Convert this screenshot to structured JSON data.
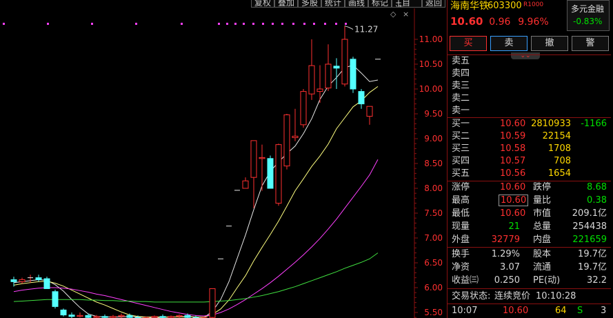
{
  "toolbar": {
    "buttons": [
      "复权",
      "叠加",
      "多股",
      "统计",
      "画线",
      "标记",
      "+自选",
      "返回"
    ]
  },
  "chart_controls": {
    "expand": "◇",
    "close": "×"
  },
  "chart_data": {
    "type": "candlestick",
    "y_tick_labels": [
      "11.00",
      "10.50",
      "10.00",
      "9.50",
      "9.00",
      "8.50",
      "8.00",
      "7.50",
      "7.00",
      "6.50",
      "6.00",
      "5.50"
    ],
    "ylim": [
      5.5,
      11.0
    ],
    "max_label": "11.27",
    "candles": [
      {
        "o": 6.16,
        "h": 6.22,
        "l": 6.02,
        "c": 6.12
      },
      {
        "o": 6.12,
        "h": 6.2,
        "l": 6.08,
        "c": 6.16
      },
      {
        "o": 6.2,
        "h": 6.26,
        "l": 6.1,
        "c": 6.2
      },
      {
        "o": 6.2,
        "h": 6.26,
        "l": 6.12,
        "c": 6.16
      },
      {
        "o": 6.18,
        "h": 6.22,
        "l": 5.98,
        "c": 5.98
      },
      {
        "o": 5.92,
        "h": 5.96,
        "l": 5.58,
        "c": 5.62
      },
      {
        "o": 5.55,
        "h": 5.58,
        "l": 5.42,
        "c": 5.45
      },
      {
        "o": 5.45,
        "h": 5.5,
        "l": 5.38,
        "c": 5.42
      },
      {
        "o": 5.42,
        "h": 5.5,
        "l": 5.4,
        "c": 5.44
      },
      {
        "o": 5.44,
        "h": 5.48,
        "l": 5.38,
        "c": 5.4
      },
      {
        "o": 5.4,
        "h": 5.45,
        "l": 5.35,
        "c": 5.42
      },
      {
        "o": 5.42,
        "h": 5.46,
        "l": 5.38,
        "c": 5.4
      },
      {
        "o": 5.4,
        "h": 5.45,
        "l": 5.36,
        "c": 5.42
      },
      {
        "o": 5.42,
        "h": 5.48,
        "l": 5.38,
        "c": 5.44
      },
      {
        "o": 5.44,
        "h": 5.48,
        "l": 5.38,
        "c": 5.4
      },
      {
        "o": 5.4,
        "h": 5.44,
        "l": 5.35,
        "c": 5.38
      },
      {
        "o": 5.38,
        "h": 5.42,
        "l": 5.34,
        "c": 5.4
      },
      {
        "o": 5.4,
        "h": 5.44,
        "l": 5.36,
        "c": 5.42
      },
      {
        "o": 5.42,
        "h": 5.46,
        "l": 5.38,
        "c": 5.4
      },
      {
        "o": 5.4,
        "h": 5.44,
        "l": 5.36,
        "c": 5.42
      },
      {
        "o": 5.42,
        "h": 5.46,
        "l": 5.38,
        "c": 5.44
      },
      {
        "o": 5.44,
        "h": 5.48,
        "l": 5.38,
        "c": 5.4
      },
      {
        "o": 5.4,
        "h": 5.44,
        "l": 5.35,
        "c": 5.38
      },
      {
        "o": 5.38,
        "h": 5.42,
        "l": 5.34,
        "c": 5.4
      },
      {
        "o": 5.4,
        "h": 5.98,
        "l": 5.38,
        "c": 5.98
      },
      {
        "o": 6.58,
        "h": 6.58,
        "l": 6.58,
        "c": 6.58
      },
      {
        "o": 7.24,
        "h": 7.24,
        "l": 7.24,
        "c": 7.24
      },
      {
        "o": 7.96,
        "h": 7.96,
        "l": 7.96,
        "c": 7.96
      },
      {
        "o": 8.0,
        "h": 8.22,
        "l": 8.0,
        "c": 8.15
      },
      {
        "o": 8.22,
        "h": 8.96,
        "l": 7.6,
        "c": 8.96
      },
      {
        "o": 8.6,
        "h": 8.88,
        "l": 7.95,
        "c": 8.62
      },
      {
        "o": 8.6,
        "h": 8.66,
        "l": 8.0,
        "c": 8.0
      },
      {
        "o": 7.7,
        "h": 8.9,
        "l": 7.65,
        "c": 8.88
      },
      {
        "o": 8.45,
        "h": 9.5,
        "l": 8.38,
        "c": 9.48
      },
      {
        "o": 9.02,
        "h": 9.6,
        "l": 8.95,
        "c": 9.05
      },
      {
        "o": 9.28,
        "h": 10.0,
        "l": 9.22,
        "c": 9.95
      },
      {
        "o": 9.9,
        "h": 11.0,
        "l": 9.78,
        "c": 10.47
      },
      {
        "o": 9.95,
        "h": 10.48,
        "l": 9.72,
        "c": 10.0
      },
      {
        "o": 10.02,
        "h": 10.9,
        "l": 9.96,
        "c": 10.5
      },
      {
        "o": 10.46,
        "h": 10.62,
        "l": 10.0,
        "c": 10.42
      },
      {
        "o": 10.1,
        "h": 11.27,
        "l": 10.05,
        "c": 11.0
      },
      {
        "o": 10.6,
        "h": 10.65,
        "l": 9.92,
        "c": 10.0
      },
      {
        "o": 9.95,
        "h": 10.0,
        "l": 9.6,
        "c": 9.7
      },
      {
        "o": 9.45,
        "h": 9.65,
        "l": 9.28,
        "c": 9.65
      },
      {
        "o": 10.6,
        "h": 10.6,
        "l": 10.6,
        "c": 10.6
      }
    ],
    "ma_series": [
      {
        "color": "#e8e8e8",
        "values": [
          6.1,
          6.12,
          6.14,
          6.16,
          6.15,
          6.06,
          5.93,
          5.76,
          5.6,
          5.47,
          5.42,
          5.41,
          5.41,
          5.41,
          5.42,
          5.41,
          5.4,
          5.4,
          5.4,
          5.41,
          5.41,
          5.42,
          5.41,
          5.4,
          5.52,
          5.76,
          6.12,
          6.59,
          7.06,
          7.57,
          8.05,
          8.34,
          8.53,
          8.7,
          8.85,
          9.1,
          9.4,
          9.79,
          10.06,
          10.23,
          10.43,
          10.48,
          10.32,
          10.15,
          10.18
        ]
      },
      {
        "color": "#ffff80",
        "values": [
          6.05,
          6.08,
          6.1,
          6.12,
          6.13,
          6.09,
          6.03,
          5.95,
          5.87,
          5.79,
          5.71,
          5.65,
          5.58,
          5.51,
          5.45,
          5.42,
          5.41,
          5.41,
          5.41,
          5.41,
          5.41,
          5.41,
          5.41,
          5.41,
          5.46,
          5.57,
          5.75,
          6.0,
          6.24,
          6.54,
          6.81,
          7.07,
          7.34,
          7.64,
          7.95,
          8.19,
          8.44,
          8.65,
          8.89,
          9.2,
          9.42,
          9.64,
          9.76,
          9.93,
          10.05
        ]
      },
      {
        "color": "#ff40ff",
        "values": [
          5.92,
          5.95,
          5.97,
          5.99,
          6.0,
          6.0,
          5.99,
          5.97,
          5.94,
          5.91,
          5.87,
          5.84,
          5.8,
          5.76,
          5.72,
          5.68,
          5.64,
          5.6,
          5.56,
          5.52,
          5.49,
          5.46,
          5.44,
          5.43,
          5.45,
          5.5,
          5.57,
          5.66,
          5.76,
          5.87,
          5.98,
          6.1,
          6.23,
          6.37,
          6.51,
          6.66,
          6.82,
          6.99,
          7.18,
          7.38,
          7.6,
          7.82,
          8.04,
          8.27,
          8.58
        ]
      },
      {
        "color": "#40e040",
        "values": [
          5.72,
          5.73,
          5.74,
          5.75,
          5.76,
          5.76,
          5.76,
          5.76,
          5.76,
          5.75,
          5.75,
          5.74,
          5.74,
          5.73,
          5.73,
          5.72,
          5.72,
          5.71,
          5.71,
          5.71,
          5.71,
          5.71,
          5.71,
          5.71,
          5.72,
          5.73,
          5.74,
          5.76,
          5.78,
          5.81,
          5.84,
          5.88,
          5.92,
          5.97,
          6.02,
          6.08,
          6.14,
          6.2,
          6.26,
          6.32,
          6.39,
          6.45,
          6.51,
          6.58,
          6.7
        ]
      }
    ]
  },
  "colors": {
    "up": "#ff3030",
    "down": "#54ffff",
    "axis": "#8a1010",
    "marker": "#ff40ff"
  },
  "stock": {
    "name": "海南华铁",
    "code": "603300",
    "badge": "R1000",
    "price": "10.60",
    "change": "0.96",
    "pct": "9.96%",
    "sector_name": "多元金融",
    "sector_change": "-0.83%"
  },
  "actions": {
    "buy": "买",
    "sell": "卖",
    "cancel": "撤",
    "alert": "警",
    "collapse": "⌄⌄"
  },
  "asks": [
    {
      "label": "卖五",
      "price": "",
      "vol": ""
    },
    {
      "label": "卖四",
      "price": "",
      "vol": ""
    },
    {
      "label": "卖三",
      "price": "",
      "vol": ""
    },
    {
      "label": "卖二",
      "price": "",
      "vol": ""
    },
    {
      "label": "卖一",
      "price": "",
      "vol": ""
    }
  ],
  "bids": [
    {
      "label": "买一",
      "price": "10.60",
      "vol": "2810933",
      "chg": "-1166"
    },
    {
      "label": "买二",
      "price": "10.59",
      "vol": "22154",
      "chg": ""
    },
    {
      "label": "买三",
      "price": "10.58",
      "vol": "1708",
      "chg": ""
    },
    {
      "label": "买四",
      "price": "10.57",
      "vol": "708",
      "chg": ""
    },
    {
      "label": "买五",
      "price": "10.56",
      "vol": "1654",
      "chg": ""
    }
  ],
  "stats": {
    "limit_up_label": "涨停",
    "limit_up": "10.60",
    "limit_down_label": "跌停",
    "limit_down": "8.68",
    "high_label": "最高",
    "high": "10.60",
    "vol_ratio_label": "量比",
    "vol_ratio": "0.38",
    "low_label": "最低",
    "low": "10.60",
    "mkt_cap_label": "市值",
    "mkt_cap": "209.1亿",
    "last_vol_label": "现量",
    "last_vol": "21",
    "total_vol_label": "总量",
    "total_vol": "254438",
    "outer_label": "外盘",
    "outer": "32779",
    "inner_label": "内盘",
    "inner": "221659",
    "turnover_label": "换手",
    "turnover": "1.29%",
    "shares_label": "股本",
    "shares": "19.7亿",
    "nav_label": "净资",
    "nav": "3.07",
    "float_label": "流通",
    "float": "19.7亿",
    "eps_label": "收益㈢",
    "eps": "0.250",
    "pe_label": "PE(动)",
    "pe": "32.2"
  },
  "status": {
    "label": "交易状态:",
    "value": "连续竞价",
    "time": "10:10:28"
  },
  "tick": {
    "time": "10:07",
    "price": "10.60",
    "vol": "64",
    "side": "S",
    "count": "3"
  }
}
